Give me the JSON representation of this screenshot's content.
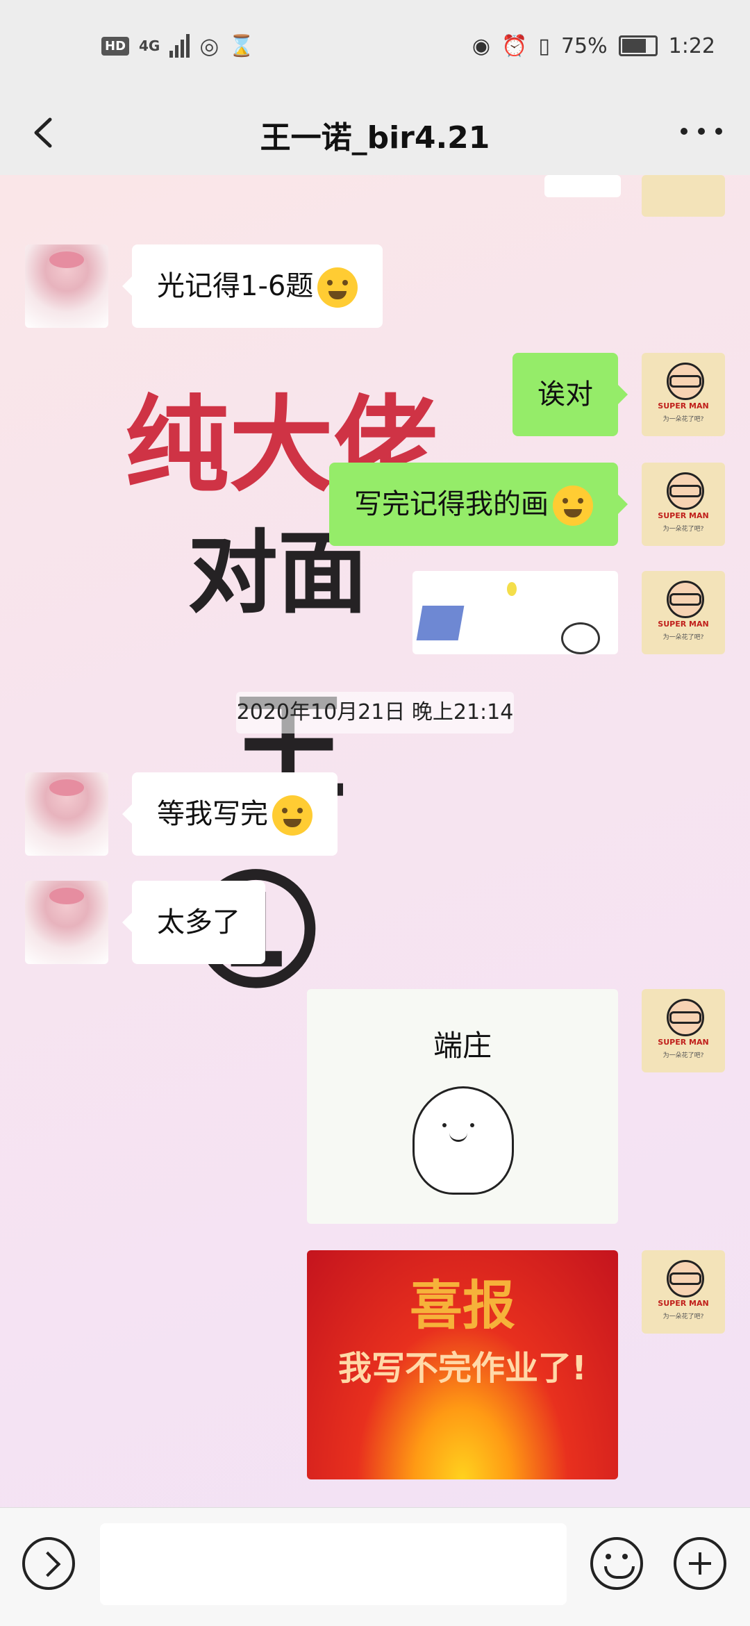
{
  "status_bar": {
    "network": "4G",
    "hd_badge": "HD",
    "battery": "75%",
    "time": "1:22"
  },
  "header": {
    "title": "王一诺_bir4.21",
    "back_icon": "chevron-left-icon",
    "more_icon": "more-dots-icon"
  },
  "watermark": {
    "line1": "纯大佬",
    "line2": "对面",
    "line3": "王",
    "line4": "①"
  },
  "messages": [
    {
      "side": "left",
      "text": "光记得1-6题",
      "emoji": "facepalm-emoji"
    },
    {
      "side": "right",
      "text": "诶对"
    },
    {
      "side": "right",
      "text": "写完记得我的画",
      "emoji": "dizzy-face-emoji"
    },
    {
      "side": "right",
      "type": "image",
      "desc": "drawing-sticker"
    },
    {
      "side": "left",
      "text": "等我写完",
      "emoji": "facepalm-emoji"
    },
    {
      "side": "left",
      "text": "太多了"
    },
    {
      "side": "right",
      "type": "sticker",
      "caption": "端庄"
    },
    {
      "side": "right",
      "type": "sticker",
      "line1": "喜报",
      "line2": "我写不完作业了!"
    }
  ],
  "timestamp": "2020年10月21日 晚上21:14",
  "avatar_man_label": "SUPER MAN",
  "avatar_man_sub": "为一朵花了吧?",
  "input": {
    "placeholder": "",
    "value": ""
  }
}
